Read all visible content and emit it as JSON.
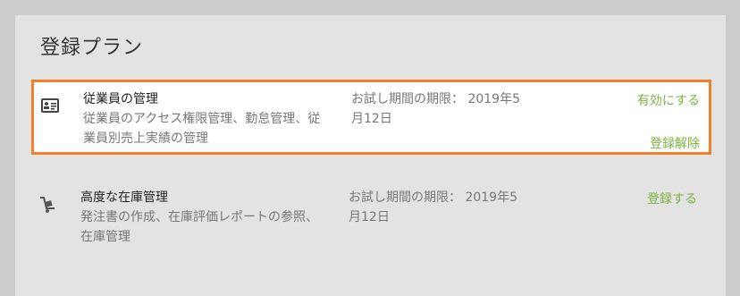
{
  "panel": {
    "title": "登録プラン"
  },
  "plans": [
    {
      "name": "従業員の管理",
      "description": "従業員のアクセス権限管理、勤怠管理、従業員別売上実績の管理",
      "trial": "お試し期間の期限： 2019年5月12日",
      "icon": "id-card-icon",
      "actions": [
        "有効にする",
        "登録解除"
      ]
    },
    {
      "name": "高度な在庫管理",
      "description": "発注書の作成、在庫評価レポートの参照、在庫管理",
      "trial": "お試し期間の期限： 2019年5月12日",
      "icon": "hand-truck-icon",
      "actions": [
        "登録する"
      ]
    }
  ],
  "colors": {
    "accent": "#7cb342",
    "highlight_border": "#f0802a"
  }
}
